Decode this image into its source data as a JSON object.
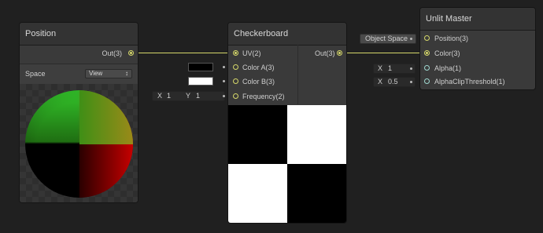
{
  "colors": {
    "background": "#202020",
    "node_body": "#3a3a3a",
    "node_header": "#333333",
    "port_vector": "#d6d86a",
    "port_scalar": "#9fd8d0",
    "wire_vector": "#d6d86a"
  },
  "position_node": {
    "title": "Position",
    "output_label": "Out(3)",
    "space_label": "Space",
    "space_value": "View",
    "dropdown_arrow": "↕"
  },
  "checkerboard_node": {
    "title": "Checkerboard",
    "inputs": {
      "uv": "UV(2)",
      "color_a": "Color A(3)",
      "color_b": "Color B(3)",
      "frequency": "Frequency(2)"
    },
    "output_label": "Out(3)",
    "color_a_value": "#000000",
    "color_b_value": "#ffffff",
    "frequency_x_label": "X",
    "frequency_x": "1",
    "frequency_y_label": "Y",
    "frequency_y": "1"
  },
  "master_node": {
    "title": "Unlit Master",
    "inputs": {
      "position": "Position(3)",
      "color": "Color(3)",
      "alpha": "Alpha(1)",
      "alpha_clip": "AlphaClipThreshold(1)"
    },
    "position_default": "Object Space",
    "alpha_x_label": "X",
    "alpha_value": "1",
    "alpha_clip_x_label": "X",
    "alpha_clip_value": "0.5"
  }
}
